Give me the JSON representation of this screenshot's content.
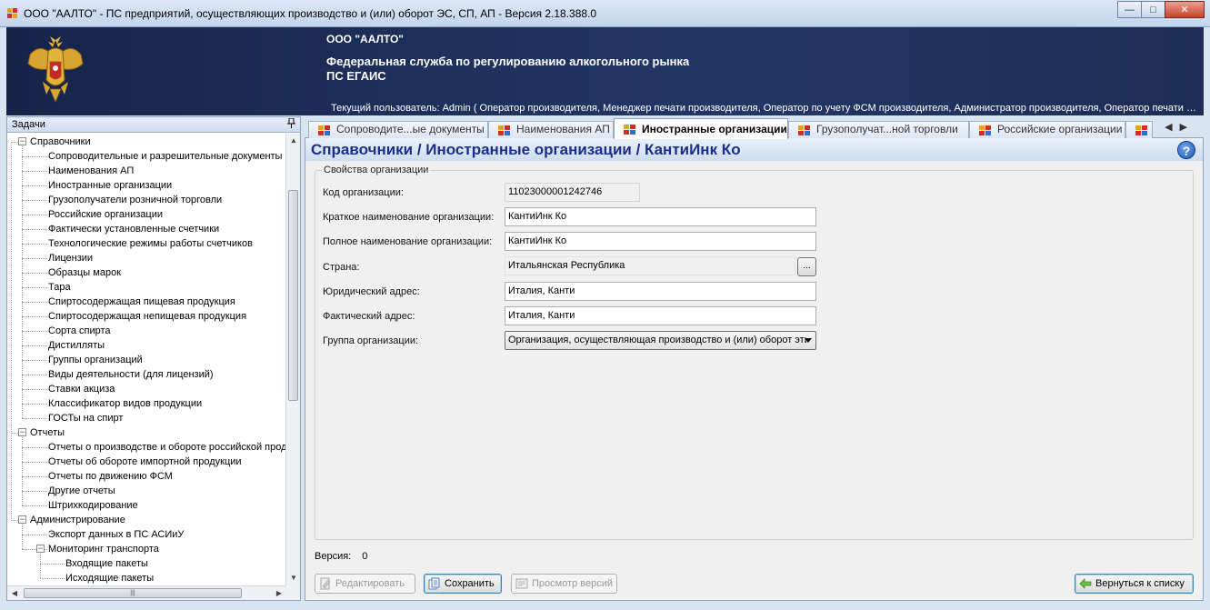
{
  "window": {
    "title": "ООО \"ААЛТО\" - ПС предприятий, осуществляющих производство и (или) оборот ЭС, СП, АП - Версия 2.18.388.0",
    "minimize": "—",
    "maximize": "□",
    "close": "✕"
  },
  "banner": {
    "org": "ООО \"ААЛТО\"",
    "service_line1": "Федеральная служба по регулированию алкогольного рынка",
    "service_line2": "ПС ЕГАИС",
    "user": "Текущий пользователь: Admin ( Оператор производителя, Менеджер печати производителя, Оператор по учету ФСМ производителя, Администратор производителя, Оператор печати производителя )"
  },
  "tasks": {
    "title": "Задачи",
    "pin": "ᵱ",
    "tree": [
      {
        "label": "Справочники",
        "level": 0,
        "expander": "−"
      },
      {
        "label": "Сопроводительные и разрешительные документы",
        "level": 1
      },
      {
        "label": "Наименования АП",
        "level": 1
      },
      {
        "label": "Иностранные организации",
        "level": 1
      },
      {
        "label": "Грузополучатели розничной торговли",
        "level": 1
      },
      {
        "label": "Российские организации",
        "level": 1
      },
      {
        "label": "Фактически установленные счетчики",
        "level": 1
      },
      {
        "label": "Технологические режимы работы счетчиков",
        "level": 1
      },
      {
        "label": "Лицензии",
        "level": 1
      },
      {
        "label": "Образцы марок",
        "level": 1
      },
      {
        "label": "Тара",
        "level": 1
      },
      {
        "label": "Спиртосодержащая пищевая продукция",
        "level": 1
      },
      {
        "label": "Спиртосодержащая непищевая продукция",
        "level": 1
      },
      {
        "label": "Сорта спирта",
        "level": 1
      },
      {
        "label": "Дистилляты",
        "level": 1
      },
      {
        "label": "Группы организаций",
        "level": 1
      },
      {
        "label": "Виды деятельности (для лицензий)",
        "level": 1
      },
      {
        "label": "Ставки акциза",
        "level": 1
      },
      {
        "label": "Классификатор видов продукции",
        "level": 1
      },
      {
        "label": "ГОСТы на спирт",
        "level": 1
      },
      {
        "label": "Отчеты",
        "level": 0,
        "expander": "−"
      },
      {
        "label": "Отчеты о производстве и обороте российской продукции",
        "level": 1
      },
      {
        "label": "Отчеты об обороте импортной продукции",
        "level": 1
      },
      {
        "label": "Отчеты по движению ФСМ",
        "level": 1
      },
      {
        "label": "Другие отчеты",
        "level": 1
      },
      {
        "label": "Штрихкодирование",
        "level": 1
      },
      {
        "label": "Администрирование",
        "level": 0,
        "expander": "−"
      },
      {
        "label": "Экспорт данных в ПС АСИиУ",
        "level": 1
      },
      {
        "label": "Мониторинг транспорта",
        "level": 1,
        "expander": "−"
      },
      {
        "label": "Входящие пакеты",
        "level": 2
      },
      {
        "label": "Исходящие пакеты",
        "level": 2
      }
    ],
    "scroll_up": "▲",
    "scroll_down": "▼",
    "scroll_left": "◀",
    "scroll_right": "▶",
    "hthumb_grip": "|||"
  },
  "tabs": [
    {
      "label": "Сопроводите...ые документы",
      "active": false
    },
    {
      "label": "Наименования АП",
      "active": false
    },
    {
      "label": "Иностранные организации",
      "active": true
    },
    {
      "label": "Грузополучат...ной торговли",
      "active": false
    },
    {
      "label": "Российские организации",
      "active": false
    },
    {
      "label": "",
      "active": false
    }
  ],
  "tab_arrows": "◀▶",
  "content": {
    "breadcrumb": "Справочники / Иностранные организации / КантиИнк Ко",
    "help": "?",
    "group_title": "Свойства организации",
    "fields": {
      "code_label": "Код организации:",
      "code_value": "11023000001242746",
      "short_label": "Краткое наименование организации:",
      "short_value": "КантиИнк Ко",
      "full_label": "Полное наименование организации:",
      "full_value": "КантиИнк Ко",
      "country_label": "Страна:",
      "country_value": "Итальянская Республика",
      "country_btn": "...",
      "legal_label": "Юридический адрес:",
      "legal_value": "Италия, Канти",
      "actual_label": "Фактический адрес:",
      "actual_value": "Италия, Канти",
      "group_label": "Группа организации:",
      "group_value": "Организация, осуществляющая производство и (или) оборот этилового спирта"
    },
    "version_label": "Версия:",
    "version_value": "0"
  },
  "buttons": {
    "edit": "Редактировать",
    "save": "Сохранить",
    "versions": "Просмотр версий",
    "back": "Вернуться к списку"
  },
  "colors": {
    "banner": "#1b2a52",
    "breadcrumb": "#1a2f8a",
    "accent": "#1d5bb5"
  }
}
